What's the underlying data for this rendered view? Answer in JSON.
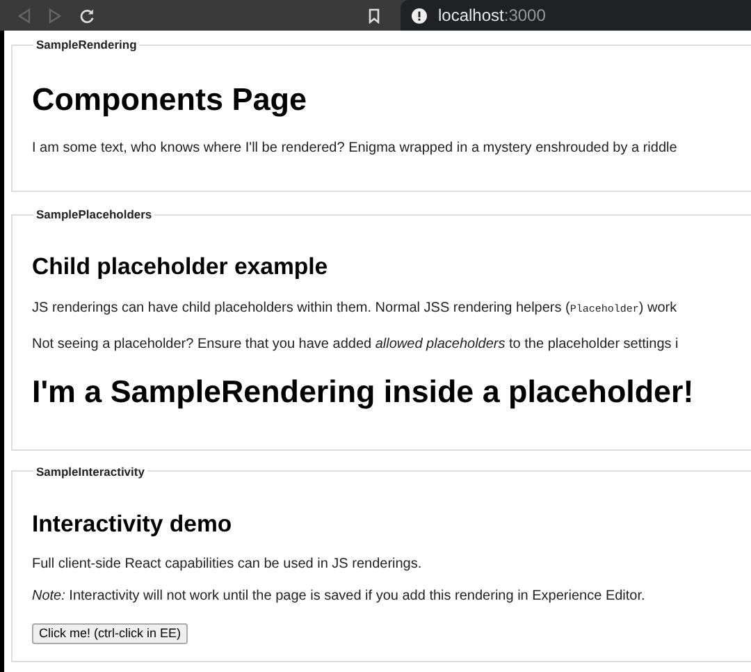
{
  "browser": {
    "address_host": "localhost",
    "address_port": ":3000"
  },
  "sections": [
    {
      "kind": "rendering",
      "legend": "SampleRendering",
      "heading": "Components Page",
      "text": "I am some text, who knows where I'll be rendered? Enigma wrapped in a mystery enshrouded by a riddle"
    },
    {
      "kind": "placeholders",
      "legend": "SamplePlaceholders",
      "heading": "Child placeholder example",
      "text_before": "JS renderings can have child placeholders within them. Normal JSS rendering helpers (",
      "code": "Placeholder",
      "text_after": ") work",
      "note": "Not seeing a placeholder? Ensure that you have added *allowed placeholders* to the placeholder settings i",
      "child_heading": "I'm a SampleRendering inside a placeholder!"
    },
    {
      "kind": "interactivity",
      "legend": "SampleInteractivity",
      "heading": "Interactivity demo",
      "text": "Full client-side React capabilities can be used in JS renderings.",
      "note": "*Note:* Interactivity will not work until the page is saved if you add this rendering in Experience Editor.",
      "button": "Click me! (ctrl-click in EE)"
    }
  ]
}
